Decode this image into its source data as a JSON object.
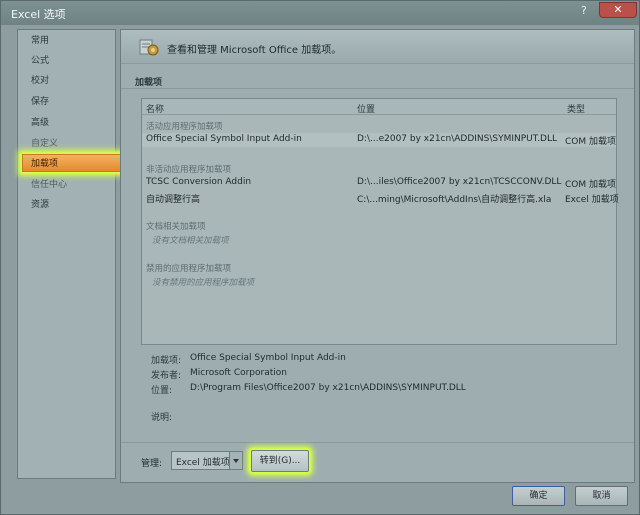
{
  "window": {
    "title": "Excel 选项",
    "help_glyph": "?",
    "close_glyph": "✕"
  },
  "nav": {
    "items": [
      {
        "label": "常用"
      },
      {
        "label": "公式"
      },
      {
        "label": "校对"
      },
      {
        "label": "保存"
      },
      {
        "label": "高级"
      },
      {
        "label": "自定义"
      },
      {
        "label": "加载项",
        "selected": true
      },
      {
        "label": "信任中心"
      },
      {
        "label": "资源"
      }
    ]
  },
  "header": {
    "intro": "查看和管理 Microsoft Office 加载项。",
    "icon": "gear-addins-icon"
  },
  "section": {
    "title": "加载项"
  },
  "table": {
    "columns": {
      "name": "名称",
      "location": "位置",
      "type": "类型"
    },
    "groups": {
      "active": "活动应用程序加载项",
      "inactive": "非活动应用程序加载项",
      "document": "文档相关加载项",
      "disabled": "禁用的应用程序加载项"
    },
    "active_rows": [
      {
        "name": "Office Special Symbol Input Add-in",
        "location": "D:\\...e2007 by x21cn\\ADDINS\\SYMINPUT.DLL",
        "type": "COM 加载项"
      }
    ],
    "inactive_rows": [
      {
        "name": "TCSC Conversion Addin",
        "location": "D:\\...iles\\Office2007 by x21cn\\TCSCCONV.DLL",
        "type": "COM 加载项"
      },
      {
        "name": "自动调整行高",
        "location": "C:\\...ming\\Microsoft\\AddIns\\自动调整行高.xla",
        "type": "Excel 加载项"
      }
    ],
    "document_empty": "没有文档相关加载项",
    "disabled_empty": "没有禁用的应用程序加载项"
  },
  "details": {
    "addin_label": "加载项:",
    "addin_value": "Office Special Symbol Input Add-in",
    "publisher_label": "发布者:",
    "publisher_value": "Microsoft Corporation",
    "location_label": "位置:",
    "location_value": "D:\\Program Files\\Office2007 by x21cn\\ADDINS\\SYMINPUT.DLL",
    "description_label": "说明:"
  },
  "manage": {
    "label": "管理:",
    "selected": "Excel 加载项",
    "goto_label": "转到(G)..."
  },
  "buttons": {
    "ok": "确定",
    "cancel": "取消"
  },
  "colors": {
    "highlight_glow": "#d6ff4a",
    "selected_tab": "#e38a2a"
  }
}
